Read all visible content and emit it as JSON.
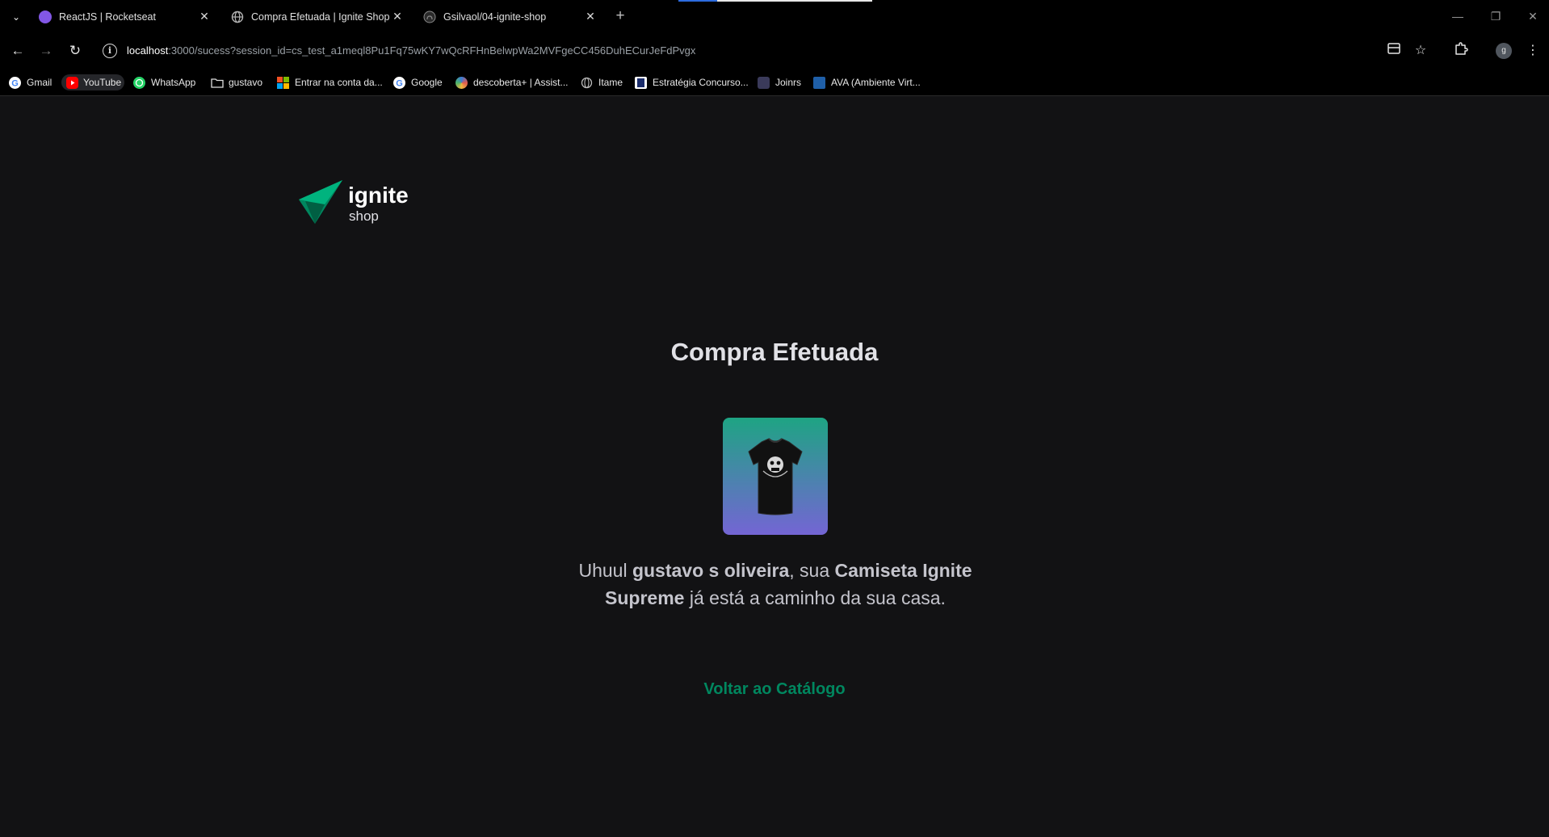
{
  "browser": {
    "tabs": [
      {
        "title": "ReactJS | Rocketseat",
        "favicon_color": "#8257e5"
      },
      {
        "title": "Compra Efetuada | Ignite Shop",
        "favicon_color": "#6b6b6b"
      },
      {
        "title": "Gsilvaol/04-ignite-shop",
        "favicon_color": "#3a3a3a"
      }
    ],
    "address": {
      "host": "localhost",
      "path": ":3000/sucess?session_id=cs_test_a1meql8Pu1Fq75wKY7wQcRFHnBelwpWa2MVFgeCC456DuhECurJeFdPvgx"
    },
    "profile_initial": "g",
    "bookmarks": [
      {
        "label": "Gmail",
        "icon": "google-icon",
        "color": "#ffffff"
      },
      {
        "label": "YouTube",
        "icon": "youtube-icon",
        "color": "#ff0000"
      },
      {
        "label": "WhatsApp",
        "icon": "whatsapp-icon",
        "color": "#25d366"
      },
      {
        "label": "gustavo",
        "icon": "folder-icon",
        "color": "#000000"
      },
      {
        "label": "Entrar na conta da...",
        "icon": "microsoft-icon",
        "color": "#f25022"
      },
      {
        "label": "Google",
        "icon": "google-icon",
        "color": "#ffffff"
      },
      {
        "label": "descoberta+ | Assist...",
        "icon": "discovery-icon",
        "color": "#3b7bd6"
      },
      {
        "label": "Itame",
        "icon": "globe-icon",
        "color": "#9a9a9a"
      },
      {
        "label": "Estratégia Concurso...",
        "icon": "estrategia-icon",
        "color": "#1a2c6b"
      },
      {
        "label": "Joinrs",
        "icon": "joinrs-icon",
        "color": "#2b2b4a"
      },
      {
        "label": "AVA (Ambiente Virt...",
        "icon": "ava-icon",
        "color": "#1f5fa8"
      }
    ]
  },
  "page": {
    "logo": {
      "word": "ignite",
      "sub": "shop",
      "mark_color": "#00b37e"
    },
    "heading": "Compra Efetuada",
    "product_image": "t-shirt-image",
    "message": {
      "intro": "Uhuul ",
      "customer": "gustavo s oliveira",
      "middle": ", sua ",
      "product": "Camiseta Ignite Supreme",
      "outro": " já está a caminho da sua casa."
    },
    "back_link": "Voltar ao Catálogo"
  }
}
